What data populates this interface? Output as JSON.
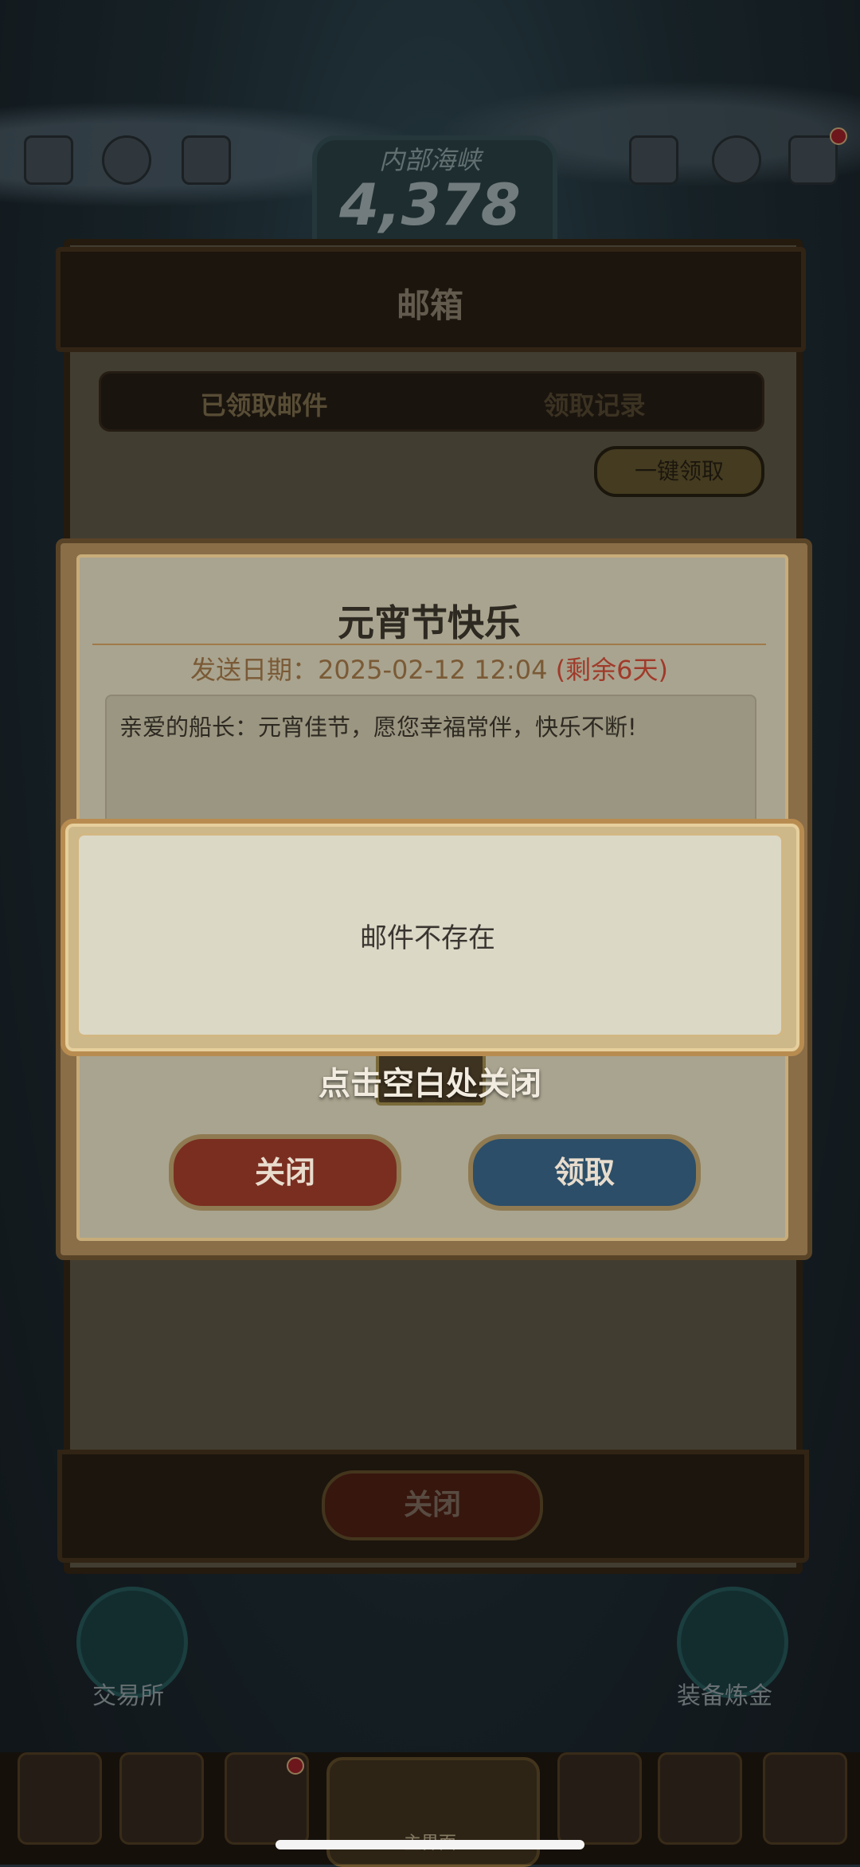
{
  "hud": {
    "zone_name": "内部海峡",
    "score": "4,378"
  },
  "mailbox": {
    "title": "邮箱",
    "tabs": [
      "已领取邮件",
      "领取记录"
    ],
    "claim_all": "一键领取",
    "close": "关闭"
  },
  "mail_detail": {
    "title": "元宵节快乐",
    "send_label": "发送日期：",
    "send_date": "2025-02-12 12:04",
    "remaining": "(剩余6天)",
    "body": "亲爱的船长：元宵佳节，愿您幸福常伴，快乐不断!",
    "close_button": "关闭",
    "claim_button": "领取"
  },
  "toast": {
    "message": "邮件不存在",
    "hint": "点击空白处关闭"
  },
  "bottom": {
    "trade": "交易所",
    "equip": "装备炼金",
    "center_tab": "主界面"
  },
  "icons": [
    "menu-icon",
    "gear-icon",
    "trophy-icon",
    "briefcase-icon",
    "friends-icon",
    "mail-icon"
  ],
  "colors": {
    "close_red": "#7a2e20",
    "claim_blue": "#2c4e68",
    "remaining_red": "#a03a2a",
    "gold_frame": "#b88c50"
  }
}
